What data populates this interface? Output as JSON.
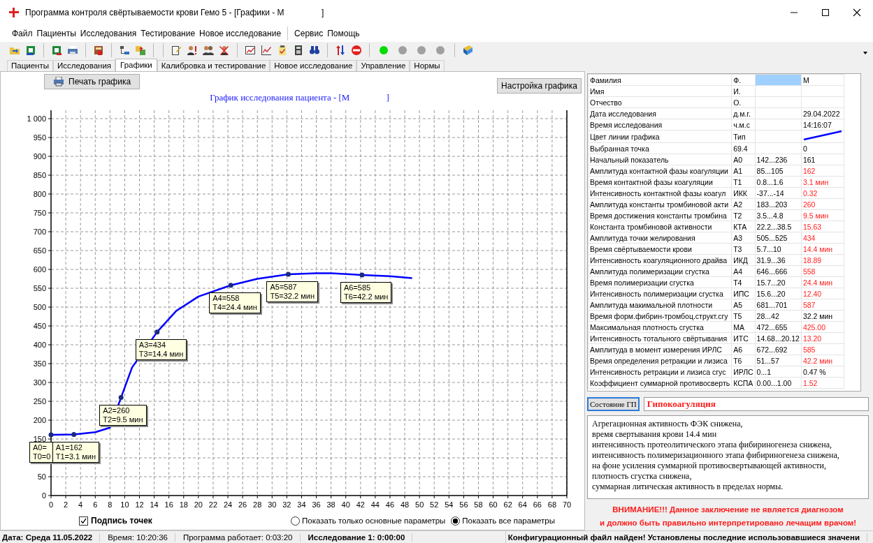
{
  "window": {
    "title": "Программа контроля свёртываемости крови Гемо 5 - [Графики - M                ]"
  },
  "menu_groups": [
    [
      "Файл",
      "Пациенты",
      "Исследования",
      "Тестирование",
      "Новое исследование"
    ],
    [
      "Сервис",
      "Помощь"
    ]
  ],
  "indicators": [
    {
      "color": "#00dd00"
    },
    {
      "color": "#a0a0a0"
    },
    {
      "color": "#a0a0a0"
    },
    {
      "color": "#a0a0a0"
    }
  ],
  "tabs": [
    {
      "label": "Пациенты",
      "selected": false
    },
    {
      "label": "Исследования",
      "selected": false
    },
    {
      "label": "Графики",
      "selected": true
    },
    {
      "label": "Калибровка и тестирование",
      "selected": false
    },
    {
      "label": "Новое исследование",
      "selected": false
    },
    {
      "label": "Управление",
      "selected": false
    },
    {
      "label": "Нормы",
      "selected": false
    }
  ],
  "graph": {
    "print_button": "Печать графика",
    "settings_button": "Настройка графика",
    "chart_data": {
      "type": "line",
      "title": "График исследования пациента - [M                ]",
      "xlim": [
        0,
        70
      ],
      "ylim": [
        0,
        1000
      ],
      "xticks": [
        0,
        2,
        4,
        6,
        8,
        10,
        12,
        14,
        16,
        18,
        20,
        22,
        24,
        26,
        28,
        30,
        32,
        34,
        36,
        38,
        40,
        42,
        44,
        46,
        48,
        50,
        52,
        54,
        56,
        58,
        60,
        62,
        64,
        66,
        68,
        70
      ],
      "grid": true,
      "yticks": [
        0,
        50,
        150,
        200,
        250,
        300,
        350,
        400,
        450,
        500,
        550,
        600,
        650,
        700,
        750,
        800,
        850,
        900,
        950,
        {
          "value": 1000,
          "label": "1 000"
        }
      ],
      "x": [
        0,
        3.1,
        6,
        8,
        9.5,
        11,
        14.4,
        17,
        20,
        24.4,
        28,
        32.2,
        36,
        38,
        42.2,
        46,
        49
      ],
      "series": [
        {
          "color": "#0000ff",
          "values": [
            161,
            162,
            168,
            180,
            260,
            340,
            434,
            490,
            528,
            558,
            575,
            587,
            590,
            590,
            585,
            582,
            577
          ]
        }
      ],
      "annotations": [
        {
          "text": "A0=\nT0=0"
        },
        {
          "text": "A1=162\nT1=3.1 мин"
        },
        {
          "text": "A2=260\nT2=9.5 мин"
        },
        {
          "text": "A3=434\nT3=14.4 мин"
        },
        {
          "text": "A4=558\nT4=24.4 мин"
        },
        {
          "text": "A5=587\nT5=32.2 мин"
        },
        {
          "text": "A6=585\nT6=42.2 мин"
        }
      ]
    },
    "point_labels": {
      "label": "Подпись точек",
      "checked": true
    },
    "display_options": [
      {
        "label": "Показать только основные параметры",
        "selected": false
      },
      {
        "label": "Показать все параметры",
        "selected": true
      }
    ]
  },
  "parameters": [
    {
      "name": "Фамилия",
      "code": "Ф.",
      "value": "M",
      "selected": true
    },
    {
      "name": "Имя",
      "code": "И.",
      "selected": false
    },
    {
      "name": "Отчество",
      "code": "О.",
      "selected": false
    },
    {
      "name": "Дата исследования",
      "code": "д.м.г.",
      "value": "29.04.2022",
      "selected": false
    },
    {
      "name": "Время исследования",
      "code": "ч.м.с",
      "value": "14:16:07",
      "selected": false
    },
    {
      "name": "Цвет линии графика",
      "code": "Тип",
      "kind": "line",
      "color": "#0000ff",
      "selected": false
    },
    {
      "name": "Выбранная точка",
      "code": "69.4",
      "value": "0",
      "selected": false
    },
    {
      "name": "Начальный показатель",
      "code": "A0",
      "norm": "142...236",
      "value": "161",
      "abnormal": false,
      "selected": false
    },
    {
      "name": "Амплитуда контактной фазы коагуляции",
      "code": "A1",
      "norm": "85...105",
      "value": "162",
      "abnormal": true,
      "selected": false
    },
    {
      "name": "Время контактной фазы коагуляции",
      "code": "T1",
      "norm": "0.8...1.6",
      "value": "3.1 мин",
      "abnormal": true,
      "selected": false
    },
    {
      "name": "Интенсивность контактной фазы коагул",
      "code": "ИКК",
      "norm": "-37...-14",
      "value": "0.32",
      "abnormal": true,
      "selected": false
    },
    {
      "name": "Амплитуда константы тромбиновой акти",
      "code": "A2",
      "norm": "183...203",
      "value": "260",
      "abnormal": true,
      "selected": false
    },
    {
      "name": "Время достижения константы тромбина",
      "code": "T2",
      "norm": "3.5...4.8",
      "value": "9.5 мин",
      "abnormal": true,
      "selected": false
    },
    {
      "name": "Константа тромбиновой активности",
      "code": "КТА",
      "norm": "22.2...38.5",
      "value": "15.63",
      "abnormal": true,
      "selected": false
    },
    {
      "name": "Амплитуда точки желирования",
      "code": "A3",
      "norm": "505...525",
      "value": "434",
      "abnormal": true,
      "selected": false
    },
    {
      "name": "Время свёртываемости крови",
      "code": "T3",
      "norm": "5.7...10",
      "value": "14.4 мин",
      "abnormal": true,
      "selected": false
    },
    {
      "name": "Интенсивность коагуляционного драйва",
      "code": "ИКД",
      "norm": "31.9...36",
      "value": "18.89",
      "abnormal": true,
      "selected": false
    },
    {
      "name": "Амплитуда полимеризации сгустка",
      "code": "A4",
      "norm": "646...666",
      "value": "558",
      "abnormal": true,
      "selected": false
    },
    {
      "name": "Время полимеризации сгустка",
      "code": "T4",
      "norm": "15.7...20",
      "value": "24.4 мин",
      "abnormal": true,
      "selected": false
    },
    {
      "name": "Интенсивность полимеризации сгустка",
      "code": "ИПС",
      "norm": "15.6...20",
      "value": "12.40",
      "abnormal": true,
      "selected": false
    },
    {
      "name": "Амплитуда макимальной плотности",
      "code": "A5",
      "norm": "681...701",
      "value": "587",
      "abnormal": true,
      "selected": false
    },
    {
      "name": "Время форм.фибрин-тромбоц.структ.сгу",
      "code": "T5",
      "norm": "28...42",
      "value": "32.2 мин",
      "abnormal": false,
      "selected": false
    },
    {
      "name": "Максимальная плотность сгустка",
      "code": "МА",
      "norm": "472...655",
      "value": "425.00",
      "abnormal": true,
      "selected": false
    },
    {
      "name": "Интенсивность тотального свёртывания",
      "code": "ИТС",
      "norm": "14.68...20.12",
      "value": "13.20",
      "abnormal": true,
      "selected": false
    },
    {
      "name": "Амплитуда в момент измерения ИРЛС",
      "code": "A6",
      "norm": "672...692",
      "value": "585",
      "abnormal": true,
      "selected": false
    },
    {
      "name": "Время определения ретракции и лизиса",
      "code": "T6",
      "norm": "51...57",
      "value": "42.2 мин",
      "abnormal": true,
      "selected": false
    },
    {
      "name": "Интенсивность ретракции и лизиса сгус",
      "code": "ИРЛС",
      "norm": "0...1",
      "value": "0.47 %",
      "abnormal": false,
      "selected": false
    },
    {
      "name": "Коэффициент суммарной противосверть",
      "code": "КСПА",
      "norm": "0.00...1.00",
      "value": "1.52",
      "abnormal": true,
      "selected": false
    }
  ],
  "state": {
    "button": "Состояние ГП",
    "value": "Гипокоагуляция"
  },
  "conclusion": [
    "Агрегационная активность ФЭК снижена,",
    "время свертывания крови 14.4 мин",
    "интенсивность протеолитического этапа фибириногенеза снижена,",
    "интенсивность полимеризационного этапа фибириногенеза снижена,",
    "на фоне усиления суммарной противосвертывающей активности,",
    "плотность сгустка снижена,",
    "суммарная литическая активность в пределах нормы."
  ],
  "warning": [
    "ВНИМАНИЕ!!! Данное заключение не является диагнозом",
    "и должно быть правильно интерпретировано лечащим врачом!"
  ],
  "status_bar": [
    {
      "text": "Дата: Среда 11.05.2022",
      "bold": true
    },
    {
      "text": "Время: 10:20:36",
      "bold": false
    },
    {
      "text": "Программа работает: 0:03:20",
      "bold": false
    },
    {
      "text": "Исследование 1: 0:00:00",
      "bold": true
    },
    {
      "text": "Конфигурационный файл найден! Установлены последние использовавшиеся значени",
      "bold": true
    }
  ]
}
